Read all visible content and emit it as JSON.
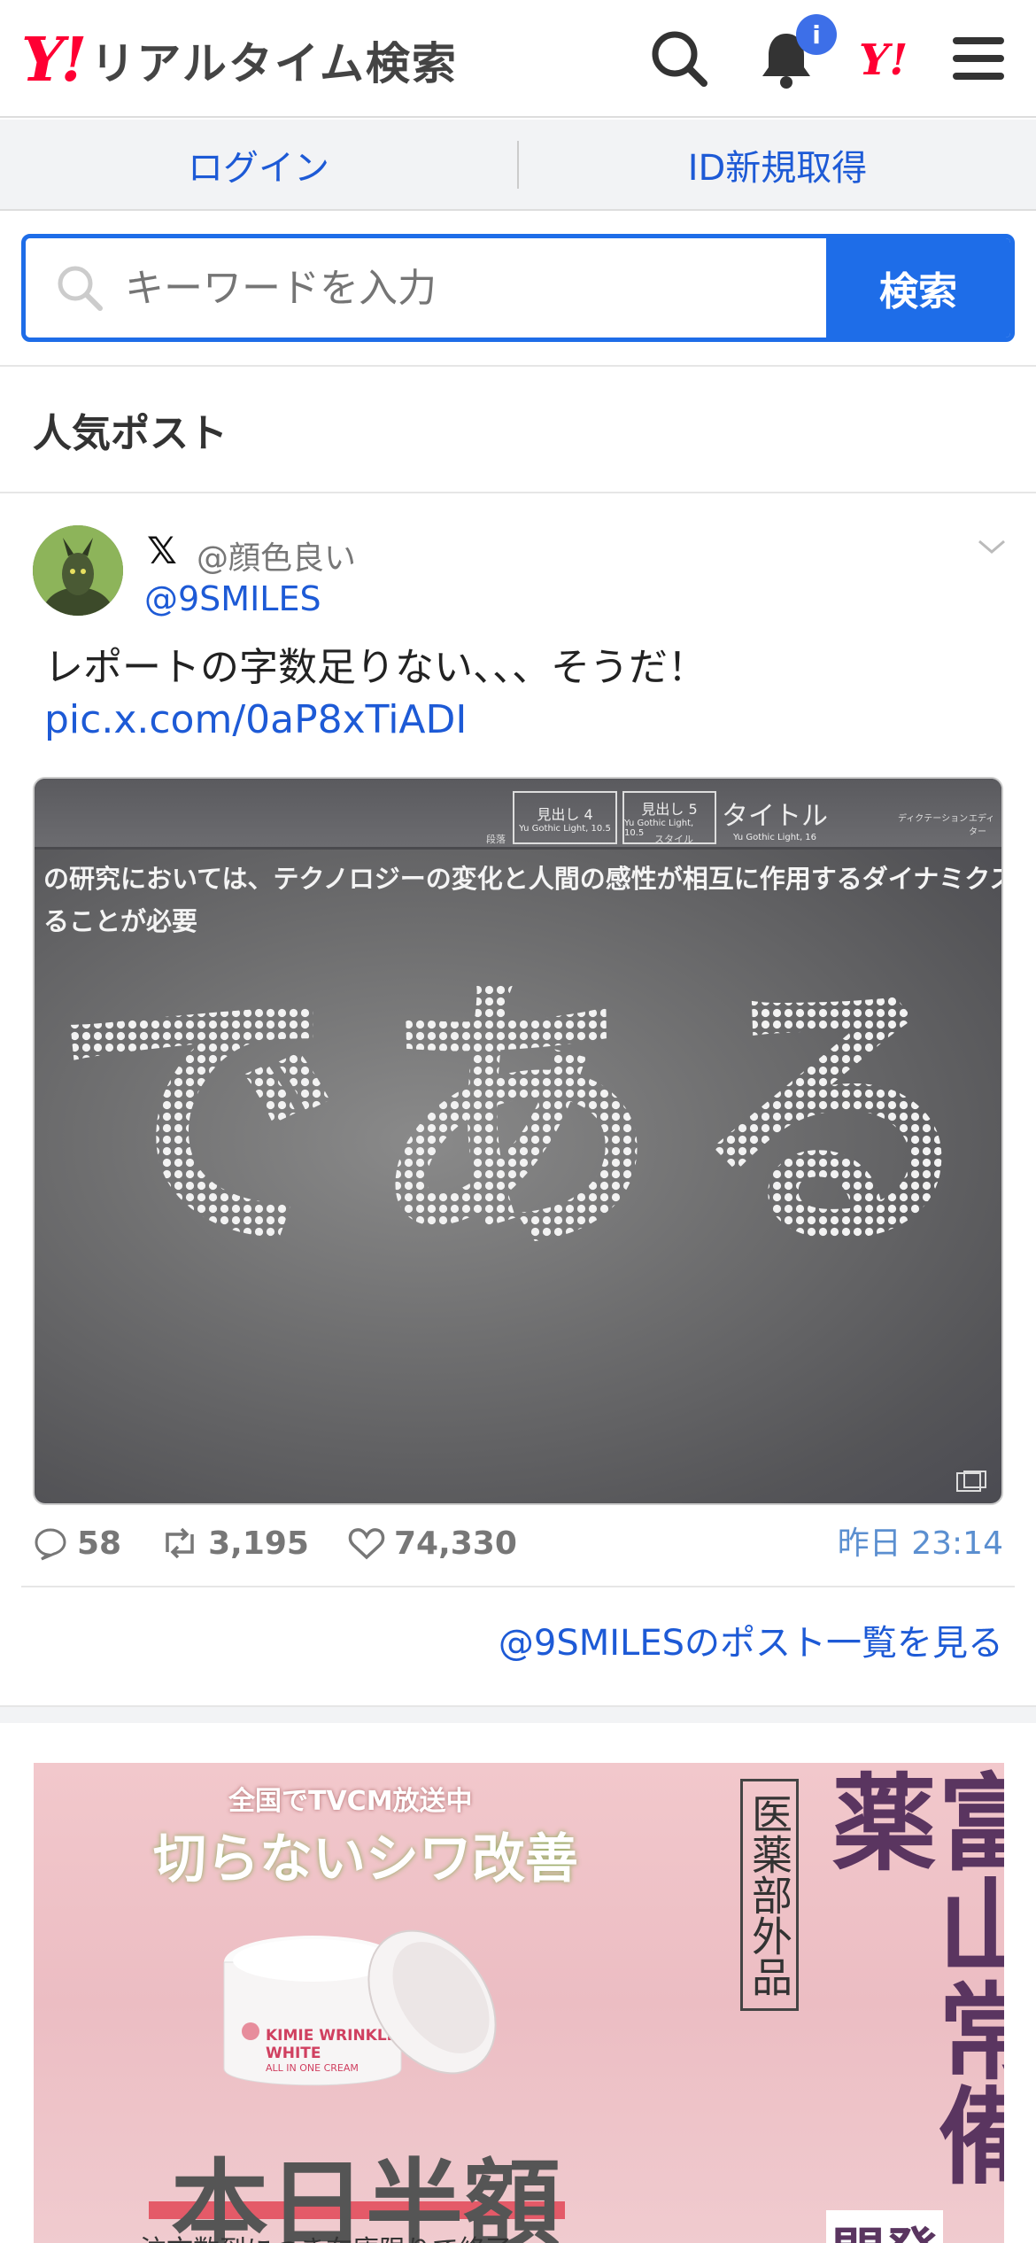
{
  "header": {
    "logo_mark": "Y!",
    "logo_text": "リアルタイム検索",
    "notification_badge": "i"
  },
  "auth": {
    "login_label": "ログイン",
    "register_label": "ID新規取得"
  },
  "search": {
    "placeholder": "キーワードを入力",
    "button_label": "検索"
  },
  "section": {
    "title": "人気ポスト"
  },
  "post": {
    "display_name": "@顔色良い",
    "handle": "@9SMILES",
    "text": "レポートの字数足りない、、、そうだ！",
    "link": "pic.x.com/0aP8xTiADI",
    "image": {
      "toolbar_styles": [
        {
          "title": "見出し 4",
          "sub": "Yu Gothic Light, 10.5"
        },
        {
          "title": "見出し 5",
          "sub": "Yu Gothic Light, 10.5"
        },
        {
          "title": "タイトル",
          "sub": "Yu Gothic Light, 16"
        }
      ],
      "toolbar_labels": [
        "段落",
        "スタイル",
        "ディクテーション",
        "エディター"
      ],
      "doc_line_1": "の研究においては、テクノロジーの変化と人間の感性が相互に作用するダイナミクスを注視す",
      "doc_line_2": "ることが必要",
      "dot_text": "である"
    },
    "replies": "58",
    "reposts": "3,195",
    "likes": "74,330",
    "time": "昨日 23:14",
    "more_link": "@9SMILESのポスト一覧を見る"
  },
  "ad": {
    "tagline": "全国でTVCM放送中",
    "headline": "切らないシワ改善",
    "quasi_drug": "医薬部外品",
    "brand": "富山常備薬",
    "brand_cut": "開発",
    "product": "KIMIE WRINKLE WHITE",
    "product_sub": "ALL IN ONE CREAM",
    "offer": "本日半額",
    "footer": "注文数到につき在庫限りで終了"
  },
  "colors": {
    "accent": "#1e6de8",
    "link": "#1d5ad6",
    "brand_red": "#ff0033"
  }
}
